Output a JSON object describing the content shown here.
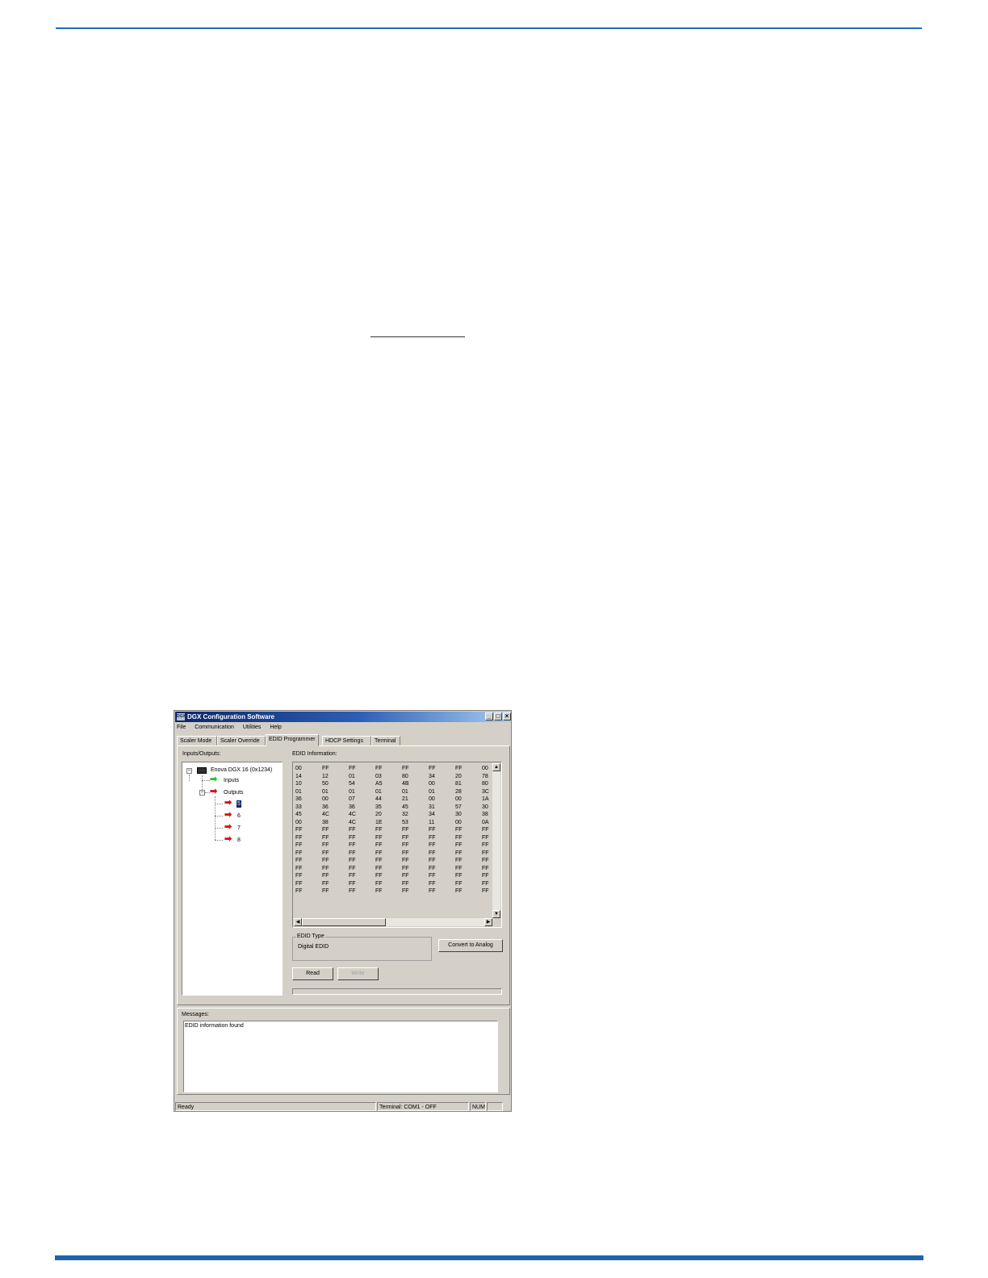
{
  "window": {
    "title": "DGX Configuration Software",
    "app_icon": "DGX",
    "controls": {
      "minimize": "_",
      "maximize": "□",
      "close": "×"
    }
  },
  "menu": [
    "File",
    "Communication",
    "Utilities",
    "Help"
  ],
  "tabs": [
    "Scaler Mode",
    "Scaler Override",
    "EDID Programmer",
    "HDCP Settings",
    "Terminal"
  ],
  "active_tab": "EDID Programmer",
  "io_panel": {
    "label": "Inputs/Outputs:",
    "device": "Enova DGX 16 (0x1234)",
    "inputs_label": "Inputs",
    "outputs_label": "Outputs",
    "outputs": [
      "5",
      "6",
      "7",
      "8"
    ],
    "selected_output": "5"
  },
  "edid": {
    "label": "EDID Information:",
    "rows": [
      [
        "00",
        "FF",
        "FF",
        "FF",
        "FF",
        "FF",
        "FF",
        "00"
      ],
      [
        "14",
        "12",
        "01",
        "03",
        "80",
        "34",
        "20",
        "78"
      ],
      [
        "10",
        "50",
        "54",
        "A5",
        "4B",
        "00",
        "81",
        "80"
      ],
      [
        "01",
        "01",
        "01",
        "01",
        "01",
        "01",
        "28",
        "3C"
      ],
      [
        "36",
        "00",
        "07",
        "44",
        "21",
        "00",
        "00",
        "1A"
      ],
      [
        "33",
        "36",
        "36",
        "35",
        "45",
        "31",
        "57",
        "30"
      ],
      [
        "45",
        "4C",
        "4C",
        "20",
        "32",
        "34",
        "30",
        "38"
      ],
      [
        "00",
        "38",
        "4C",
        "1E",
        "53",
        "11",
        "00",
        "0A"
      ],
      [
        "FF",
        "FF",
        "FF",
        "FF",
        "FF",
        "FF",
        "FF",
        "FF"
      ],
      [
        "FF",
        "FF",
        "FF",
        "FF",
        "FF",
        "FF",
        "FF",
        "FF"
      ],
      [
        "FF",
        "FF",
        "FF",
        "FF",
        "FF",
        "FF",
        "FF",
        "FF"
      ],
      [
        "FF",
        "FF",
        "FF",
        "FF",
        "FF",
        "FF",
        "FF",
        "FF"
      ],
      [
        "FF",
        "FF",
        "FF",
        "FF",
        "FF",
        "FF",
        "FF",
        "FF"
      ],
      [
        "FF",
        "FF",
        "FF",
        "FF",
        "FF",
        "FF",
        "FF",
        "FF"
      ],
      [
        "FF",
        "FF",
        "FF",
        "FF",
        "FF",
        "FF",
        "FF",
        "FF"
      ],
      [
        "FF",
        "FF",
        "FF",
        "FF",
        "FF",
        "FF",
        "FF",
        "FF"
      ],
      [
        "FF",
        "FF",
        "FF",
        "FF",
        "FF",
        "FF",
        "FF",
        "FF"
      ]
    ],
    "type_label": "EDID Type",
    "type_value": "Digital EDID",
    "convert_button": "Convert to Analog",
    "read_button": "Read",
    "write_button": "Write"
  },
  "messages": {
    "label": "Messages:",
    "text": "EDID information found"
  },
  "status": {
    "ready": "Ready",
    "terminal": "Terminal: COM1 - OFF",
    "num": "NUM"
  },
  "colors": {
    "rule_blue": "#1f6fb5",
    "title_bar": "#0a246a",
    "input_arrow": "#2ec02e",
    "output_arrow": "#e01010",
    "window_face": "#d4d0c8"
  },
  "icons": [
    "green-right-arrow-icon",
    "red-right-arrow-icon",
    "device-icon",
    "expander-minus-icon"
  ]
}
